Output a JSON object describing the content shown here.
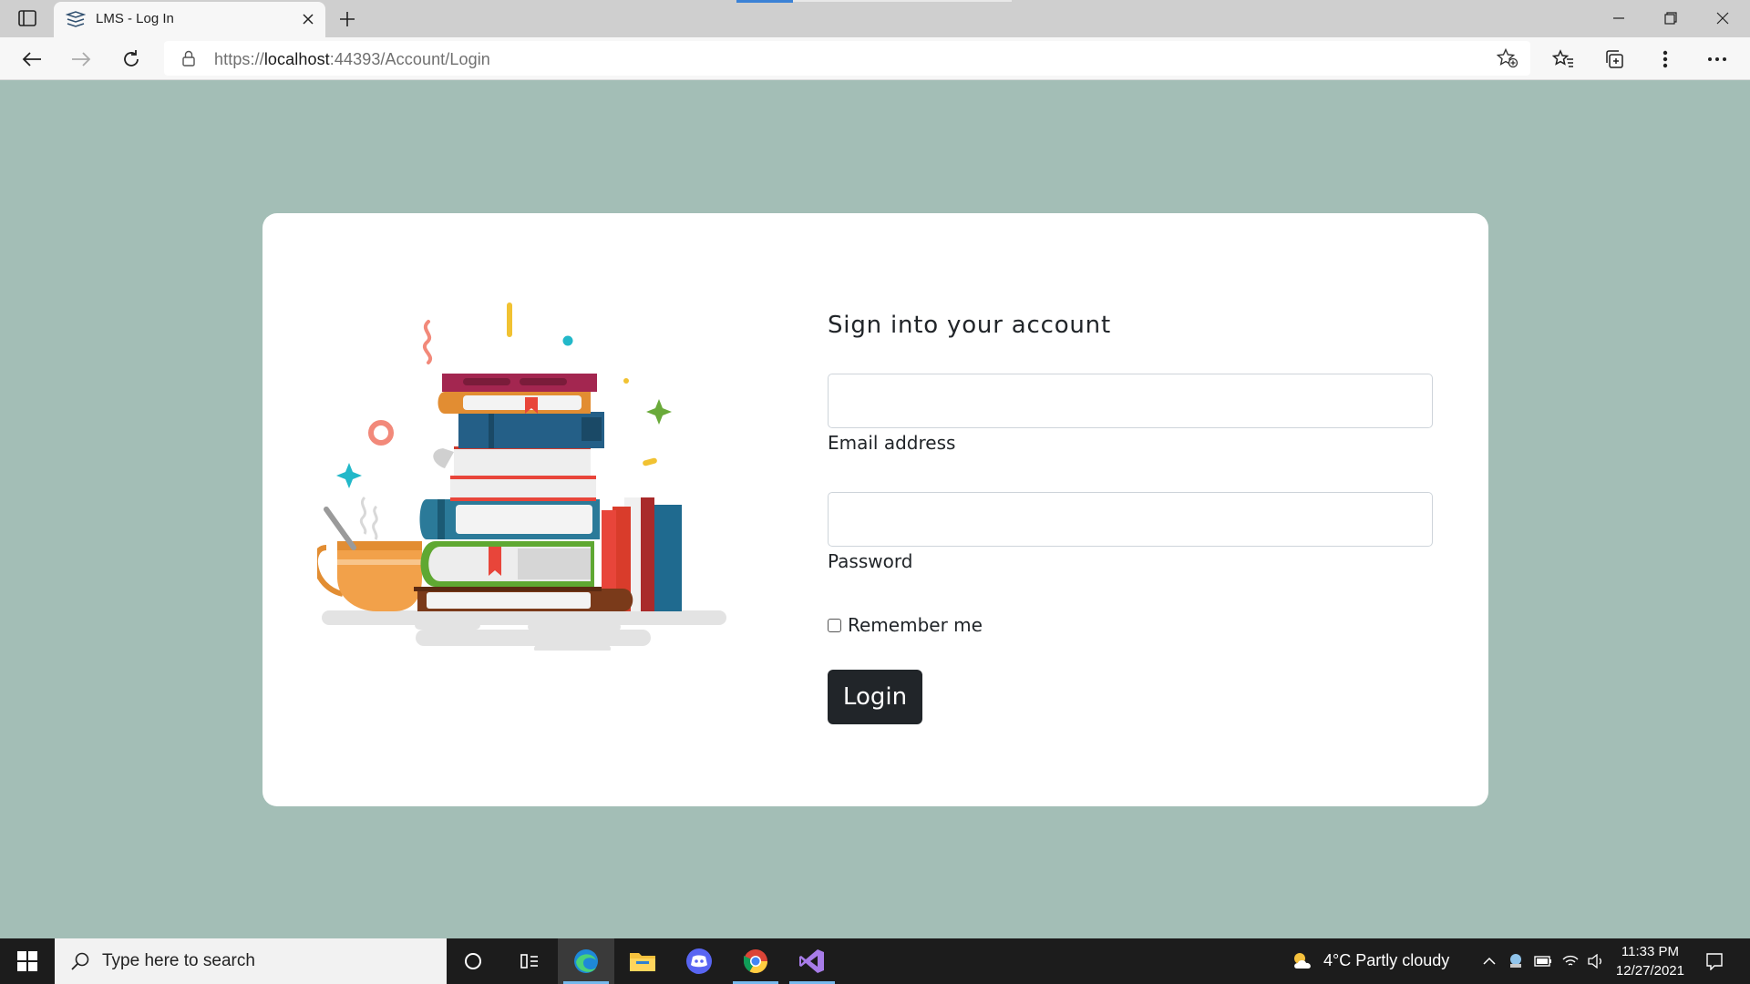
{
  "browser": {
    "tab_title": "LMS - Log In",
    "url_proto": "https://",
    "url_host": "localhost",
    "url_rest": ":44393/Account/Login"
  },
  "login": {
    "title": "Sign into your account",
    "email_label": "Email address",
    "email_value": "",
    "password_label": "Password",
    "password_value": "",
    "remember_label": "Remember me",
    "remember_checked": false,
    "login_button": "Login"
  },
  "taskbar": {
    "search_placeholder": "Type here to search",
    "weather": "4°C  Partly cloudy",
    "time": "11:33 PM",
    "date": "12/27/2021"
  },
  "colors": {
    "page_background": "#a3beb6",
    "button": "#212529"
  }
}
